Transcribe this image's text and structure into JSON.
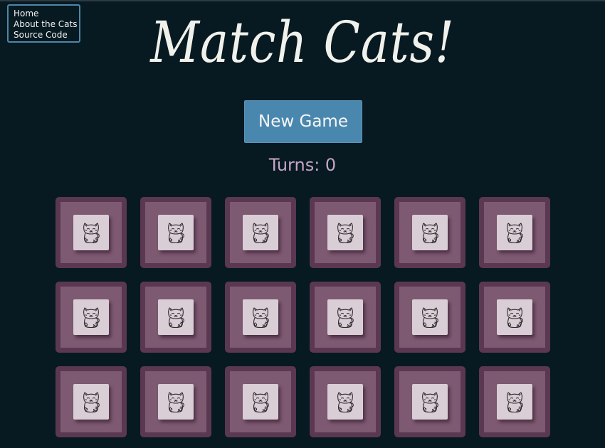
{
  "nav": {
    "links": [
      "Home",
      "About the Cats",
      "Source Code"
    ]
  },
  "title": "Match Cats!",
  "new_game_label": "New Game",
  "turns_text": "Turns: 0",
  "board": {
    "rows": 3,
    "columns": 6,
    "card_face": "cat-icon",
    "state": "face-down"
  },
  "colors": {
    "background": "#071921",
    "nav_border": "#4f86a8",
    "button": "#4a87ae",
    "turns_text": "#c6a6c6",
    "card": "#7e5a72",
    "card_border": "#5a3852",
    "tile": "#d9ced6"
  }
}
